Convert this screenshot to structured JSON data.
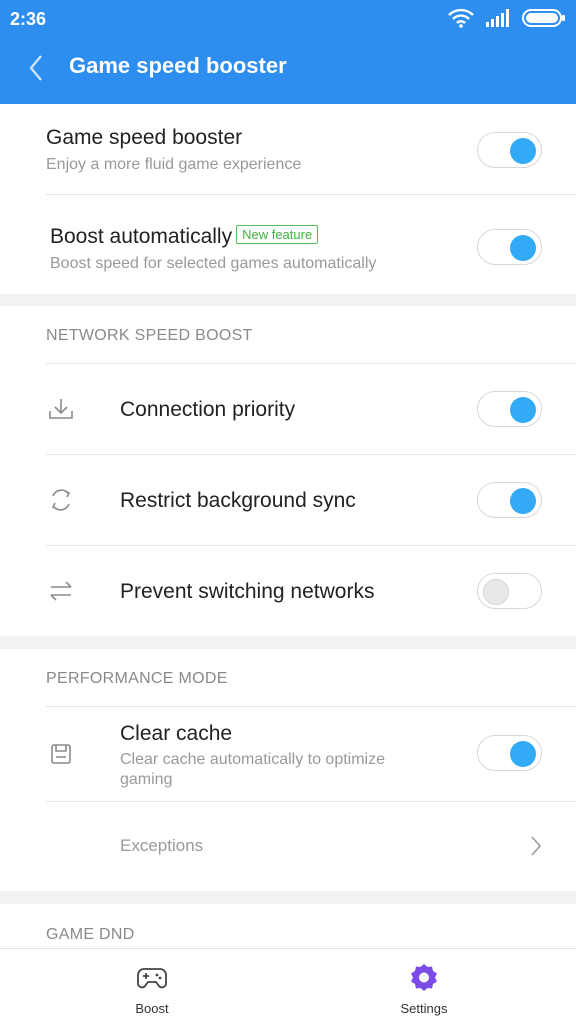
{
  "status_bar": {
    "time": "2:36",
    "icons": [
      "wifi-icon",
      "signal-icon",
      "battery-icon"
    ]
  },
  "app_bar": {
    "title": "Game speed booster",
    "back_icon": "chevron-left-icon"
  },
  "top_settings": [
    {
      "title": "Game speed booster",
      "subtitle": "Enjoy a more fluid game experience",
      "enabled": true
    },
    {
      "title": "Boost automatically",
      "badge": "New feature",
      "subtitle": "Boost speed for selected games automatically",
      "enabled": true
    }
  ],
  "network": {
    "header": "NETWORK SPEED BOOST",
    "items": [
      {
        "title": "Connection priority",
        "icon": "download-icon",
        "enabled": true
      },
      {
        "title": "Restrict background sync",
        "icon": "sync-icon",
        "enabled": true
      },
      {
        "title": "Prevent switching networks",
        "icon": "swap-arrows-icon",
        "enabled": false
      }
    ]
  },
  "performance": {
    "header": "PERFORMANCE MODE",
    "clear_cache": {
      "title": "Clear cache",
      "subtitle": "Clear cache automatically to optimize gaming",
      "icon": "save-icon",
      "enabled": true
    },
    "exceptions": {
      "label": "Exceptions",
      "icon": "chevron-right-icon"
    }
  },
  "game_dnd": {
    "header": "GAME DND"
  },
  "bottom_nav": [
    {
      "label": "Boost",
      "icon": "gamepad-icon",
      "active": false
    },
    {
      "label": "Settings",
      "icon": "gear-icon",
      "active": true
    }
  ],
  "colors": {
    "app_bar": "#2d8ef0",
    "toggle_on": "#33aaf5",
    "badge_green": "#3fb33f",
    "settings_icon_active": "#7b4be6"
  }
}
